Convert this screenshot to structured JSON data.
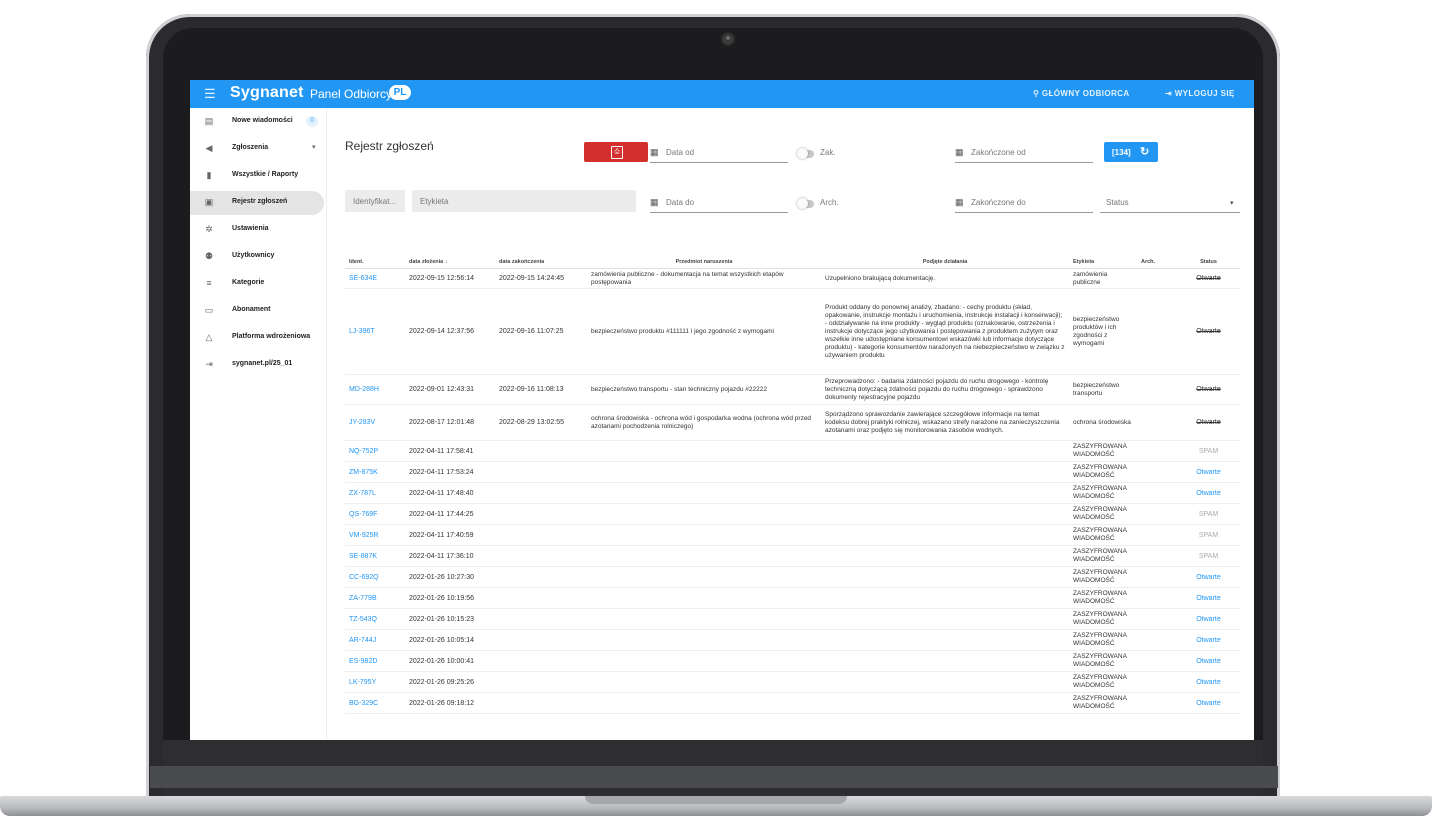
{
  "topbar": {
    "logo": "Sygnanet",
    "panel_title": "Panel Odbiorcy",
    "lang": "PL",
    "main_receiver": "GŁÓWNY ODBIORCA",
    "logout": "WYLOGUJ SIĘ"
  },
  "sidebar": {
    "items": [
      {
        "label": "Nowe wiadomości",
        "icon": "inbox-icon",
        "count": "0"
      },
      {
        "label": "Zgłoszenia",
        "icon": "megaphone-icon"
      },
      {
        "label": "Wszystkie / Raporty",
        "icon": "reports-icon"
      },
      {
        "label": "Rejestr zgłoszeń",
        "icon": "register-icon"
      },
      {
        "label": "Ustawienia",
        "icon": "gear-icon"
      },
      {
        "label": "Użytkownicy",
        "icon": "users-icon"
      },
      {
        "label": "Kategorie",
        "icon": "categories-icon"
      },
      {
        "label": "Abonament",
        "icon": "card-icon"
      },
      {
        "label": "Platforma wdrożeniowa",
        "icon": "graduation-icon"
      },
      {
        "label": "sygnanet.pl/25_01",
        "icon": "login-icon"
      }
    ]
  },
  "page": {
    "title": "Rejestr zgłoszeń",
    "filters": {
      "date_from": "Data od",
      "date_to": "Data do",
      "closed_toggle": "Zak.",
      "arch_toggle": "Arch.",
      "closed_from": "Zakończone od",
      "closed_to": "Zakończone do",
      "identifier": "Identyfikat...",
      "label": "Etykieta",
      "status": "Status",
      "refresh_count": "[134]"
    }
  },
  "table": {
    "headers": [
      "Ident.",
      "data złożenia ↓",
      "data zakończenia",
      "Przedmiot naruszenia",
      "Podjęte działania",
      "Etykieta",
      "Arch.",
      "Status"
    ],
    "rows": [
      {
        "id": "SE-634E",
        "submitted": "2022-09-15 12:56:14",
        "closed": "2022-09-15 14:24:45",
        "subject": "zamówienia publiczne - dokumentacja na temat wszystkich etapów postępowania",
        "actions": "Uzupełniono brakującą dokumentację.",
        "label": "zamówienia publiczne",
        "status": "Otwarte",
        "status_type": "closed"
      },
      {
        "id": "LJ-396T",
        "submitted": "2022-09-14 12:37:56",
        "closed": "2022-09-16 11:07:25",
        "subject": "bezpieczeństwo produktu #111111 i jego zgodność z wymogami",
        "actions": "Produkt oddany do ponownej analizy, zbadano: - cechy produktu (skład, opakowanie, instrukcje montażu i uruchomienia, instrukcje instalacji i konserwacji); - oddziaływanie na inne produkty - wygląd produktu (oznakowanie, ostrzeżenia i instrukcje dotyczące jego użytkowania i postępowania z produktem zużytym oraz wszelkie inne udostępniane konsumentowi wskazówki lub informacje dotyczące produktu) - kategorie konsumentów narażonych na niebezpieczeństwo w związku z używaniem produktu",
        "label": "bezpieczeństwo produktów i ich zgodności z wymogami",
        "status": "Otwarte",
        "status_type": "closed"
      },
      {
        "id": "MD-288H",
        "submitted": "2022-09-01 12:43:31",
        "closed": "2022-09-16 11:08:13",
        "subject": "bezpieczeństwo transportu - stan techniczny pojazdu #22222",
        "actions": "Przeprowadzono: - badania zdatności pojazdu do ruchu drogowego - kontrolę techniczną dotyczącą zdatności pojazdu do ruchu drogowego - sprawdzono dokumenty rejestracyjne pojazdu",
        "label": "bezpieczeństwo transportu",
        "status": "Otwarte",
        "status_type": "closed"
      },
      {
        "id": "JY-283V",
        "submitted": "2022-08-17 12:01:48",
        "closed": "2022-08-29 13:02:55",
        "subject": "ochrona środowiska - ochrona wód i gospodarka wodna (ochrona wód przed azotanami pochodzenia rolniczego)",
        "actions": "Sporządzono sprawozdanie zawierające szczegółowe informacje na temat kodeksu dobrej praktyki rolniczej, wskazano strefy narażone na zanieczyszczenia azotanami oraz podjęto się monitorowania zasobów wodnych.",
        "label": "ochrona środowiska",
        "status": "Otwarte",
        "status_type": "closed"
      },
      {
        "id": "NQ-752P",
        "submitted": "2022-04-11 17:58:41",
        "closed": "",
        "subject": "",
        "actions": "",
        "label": "ZASZYFROWANA WIADOMOŚĆ",
        "status": "SPAM",
        "status_type": "spam"
      },
      {
        "id": "ZM-875K",
        "submitted": "2022-04-11 17:53:24",
        "closed": "",
        "subject": "",
        "actions": "",
        "label": "ZASZYFROWANA WIADOMOŚĆ",
        "status": "Otwarte",
        "status_type": "open"
      },
      {
        "id": "ZX-787L",
        "submitted": "2022-04-11 17:48:40",
        "closed": "",
        "subject": "",
        "actions": "",
        "label": "ZASZYFROWANA WIADOMOŚĆ",
        "status": "Otwarte",
        "status_type": "open"
      },
      {
        "id": "QS-769F",
        "submitted": "2022-04-11 17:44:25",
        "closed": "",
        "subject": "",
        "actions": "",
        "label": "ZASZYFROWANA WIADOMOŚĆ",
        "status": "SPAM",
        "status_type": "spam"
      },
      {
        "id": "VM-925R",
        "submitted": "2022-04-11 17:40:59",
        "closed": "",
        "subject": "",
        "actions": "",
        "label": "ZASZYFROWANA WIADOMOŚĆ",
        "status": "SPAM",
        "status_type": "spam"
      },
      {
        "id": "SE-887K",
        "submitted": "2022-04-11 17:36:10",
        "closed": "",
        "subject": "",
        "actions": "",
        "label": "ZASZYFROWANA WIADOMOŚĆ",
        "status": "SPAM",
        "status_type": "spam"
      },
      {
        "id": "CC-692Q",
        "submitted": "2022-01-26 10:27:30",
        "closed": "",
        "subject": "",
        "actions": "",
        "label": "ZASZYFROWANA WIADOMOŚĆ",
        "status": "Otwarte",
        "status_type": "open"
      },
      {
        "id": "ZA-779B",
        "submitted": "2022-01-26 10:19:56",
        "closed": "",
        "subject": "",
        "actions": "",
        "label": "ZASZYFROWANA WIADOMOŚĆ",
        "status": "Otwarte",
        "status_type": "open"
      },
      {
        "id": "TZ-543Q",
        "submitted": "2022-01-26 10:15:23",
        "closed": "",
        "subject": "",
        "actions": "",
        "label": "ZASZYFROWANA WIADOMOŚĆ",
        "status": "Otwarte",
        "status_type": "open"
      },
      {
        "id": "AR-744J",
        "submitted": "2022-01-26 10:05:14",
        "closed": "",
        "subject": "",
        "actions": "",
        "label": "ZASZYFROWANA WIADOMOŚĆ",
        "status": "Otwarte",
        "status_type": "open"
      },
      {
        "id": "ES-982D",
        "submitted": "2022-01-26 10:00:41",
        "closed": "",
        "subject": "",
        "actions": "",
        "label": "ZASZYFROWANA WIADOMOŚĆ",
        "status": "Otwarte",
        "status_type": "open"
      },
      {
        "id": "LK-795Y",
        "submitted": "2022-01-26 09:25:26",
        "closed": "",
        "subject": "",
        "actions": "",
        "label": "ZASZYFROWANA WIADOMOŚĆ",
        "status": "Otwarte",
        "status_type": "open"
      },
      {
        "id": "BG-329C",
        "submitted": "2022-01-26 09:18:12",
        "closed": "",
        "subject": "",
        "actions": "",
        "label": "ZASZYFROWANA WIADOMOŚĆ",
        "status": "Otwarte",
        "status_type": "open"
      }
    ]
  },
  "colors": {
    "accent": "#2196f3",
    "pdf_button": "#d32f2f"
  }
}
